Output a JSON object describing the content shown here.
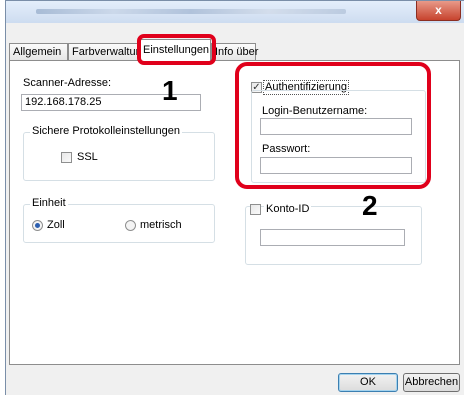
{
  "window": {
    "close_glyph": "x",
    "accent_color": "#c7432e"
  },
  "tabs": [
    {
      "label": "Allgemein"
    },
    {
      "label": "Farbverwaltur"
    },
    {
      "label": "Einstellungen"
    },
    {
      "label": "Info über"
    }
  ],
  "scanner": {
    "address_label": "Scanner-Adresse:",
    "address_value": "192.168.178.25"
  },
  "protocol": {
    "group_label": "Sichere Protokolleinstellungen",
    "ssl_label": "SSL",
    "ssl_checked": false
  },
  "unit": {
    "group_label": "Einheit",
    "options": [
      {
        "label": "Zoll",
        "selected": true
      },
      {
        "label": "metrisch",
        "selected": false
      }
    ]
  },
  "auth": {
    "label": "Authentifizierung",
    "checked": true,
    "check_glyph": "✓",
    "login_label": "Login-Benutzername:",
    "login_value": "",
    "password_label": "Passwort:",
    "password_value": ""
  },
  "account": {
    "label": "Konto-ID",
    "checked": false,
    "value": ""
  },
  "buttons": {
    "ok": "OK",
    "cancel": "Abbrechen"
  },
  "callouts": {
    "marker_1": "1",
    "marker_2": "2",
    "highlight_color": "#e0001b"
  }
}
